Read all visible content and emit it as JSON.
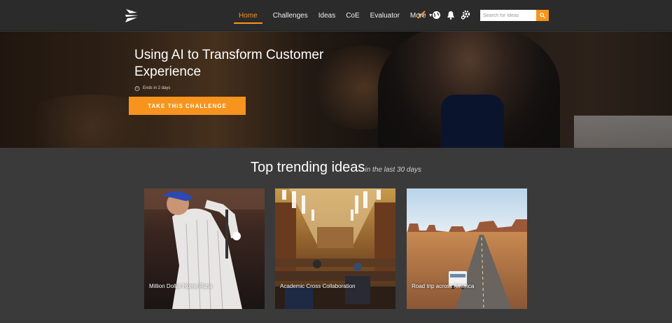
{
  "nav": {
    "links": [
      {
        "label": "Home",
        "active": true
      },
      {
        "label": "Challenges"
      },
      {
        "label": "Ideas"
      },
      {
        "label": "CoE"
      },
      {
        "label": "Evaluator"
      },
      {
        "label": "More"
      }
    ],
    "icons": [
      "chart-pen-icon",
      "globe-icon",
      "bell-icon",
      "gear-icon"
    ],
    "search": {
      "placeholder": "Search for Ideas"
    },
    "accent_color": "#f7941d"
  },
  "hero": {
    "title": "Using AI to Transform Customer Experience",
    "deadline": "Ends in 2 days",
    "cta": "TAKE THIS CHALLENGE"
  },
  "trending": {
    "title": "Top trending ideas",
    "subtitle": "in the last 30 days",
    "cards": [
      {
        "label": "Million Dollar Home Runs"
      },
      {
        "label": "Academic Cross Collaboration"
      },
      {
        "label": "Road trip across America"
      }
    ]
  }
}
